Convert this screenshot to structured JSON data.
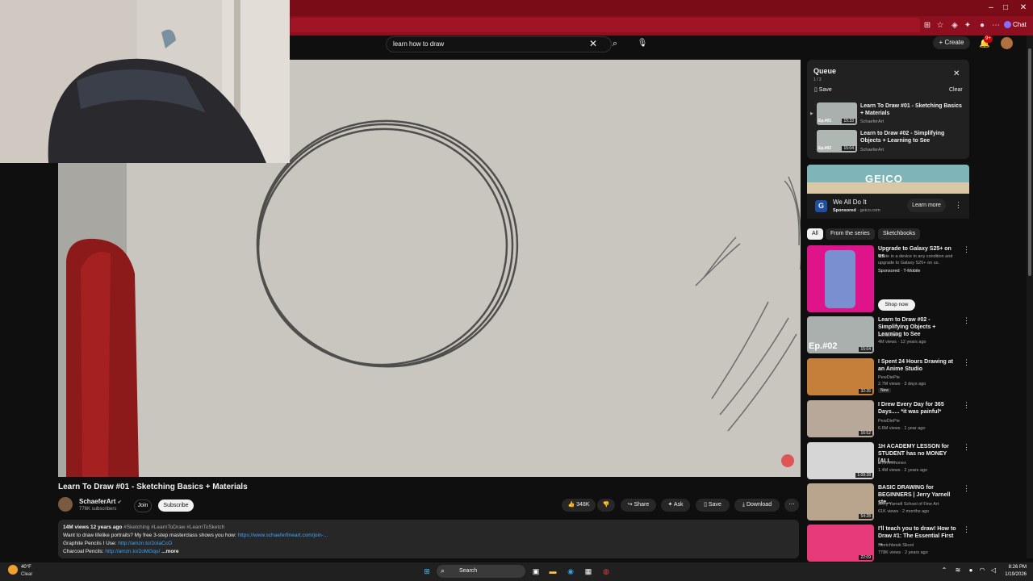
{
  "browser": {
    "window_buttons": {
      "minimize": "–",
      "maximize": "□",
      "close": "✕"
    },
    "chat_label": "Chat",
    "toolbar_icons": [
      "extension-icon",
      "star-icon",
      "shield-icon",
      "puzzle-icon",
      "split-icon",
      "profile-icon",
      "menu-icon"
    ]
  },
  "header": {
    "search_value": "learn how to draw",
    "create_label": "Create",
    "notifications_badge": "9+"
  },
  "video": {
    "title": "Learn To Draw #01 - Sketching Basics + Materials",
    "channel": "SchaeferArt",
    "subscribers": "776K subscribers",
    "join_label": "Join",
    "subscribe_label": "Subscribe",
    "likes": "348K",
    "share_label": "Share",
    "ask_label": "Ask",
    "save_label": "Save",
    "download_label": "Download",
    "description": {
      "meta": "14M views  12 years ago",
      "hashtags": "#Sketching #LearnToDraw #LearnToSketch",
      "line1_text": "Want to draw lifelike portraits? My free 3-step masterclass shows you how: ",
      "line1_link": "https://www.schaeferfineart.com/join-...",
      "line2_text": "Graphite Pencils I Use: ",
      "line2_link": "http://amzn.to/2oIaCcO",
      "line3_text": "Charcoal Pencils: ",
      "line3_link": "http://amzn.to/2oMGqu/",
      "more": " ...more"
    }
  },
  "queue": {
    "title": "Queue",
    "position": "1 / 2",
    "save_label": "Save",
    "clear_label": "Clear",
    "items": [
      {
        "title": "Learn To Draw #01 - Sketching Basics + Materials",
        "channel": "SchaeferArt",
        "duration": "15:33",
        "badge": "Ep.#01"
      },
      {
        "title": "Learn to Draw #02 - Simplifying Objects + Learning to See",
        "channel": "SchaeferArt",
        "duration": "15:04",
        "badge": "Ep.#02"
      }
    ]
  },
  "ad": {
    "brand": "GEICO",
    "tagline": "We All Do It",
    "sponsored": "Sponsored",
    "domain": "· geico.com",
    "learn_more": "Learn more"
  },
  "chips": [
    "All",
    "From the series",
    "Sketchbooks"
  ],
  "recommendations": [
    {
      "title": "Upgrade to Galaxy S25+ on us",
      "line2": "Trade in a device in any condition and upgrade to Galaxy S25+ on us.",
      "line3": "Sponsored · T-Mobile",
      "cta": "Shop now",
      "duration": ""
    },
    {
      "title": "Learn to Draw #02 - Simplifying Objects + Learning to See",
      "line2": "SchaeferArt",
      "line3": "4M views · 12 years ago",
      "duration": "15:04",
      "badge": "Ep.#02"
    },
    {
      "title": "I Spent 24 Hours Drawing at an Anime Studio",
      "line2": "PewDiePie",
      "line3": "2.7M views · 3 days ago",
      "tag": "New",
      "duration": "32:35"
    },
    {
      "title": "I Drew Every Day for 365 Days..... *it was painful*",
      "line2": "PewDiePie",
      "line3": "6.6M views · 1 year ago",
      "duration": "16:52"
    },
    {
      "title": "1H ACADEMY LESSON for STUDENT has no MONEY [ALL...",
      "line2": "Mmmmmonex",
      "line3": "1.4M views · 2 years ago",
      "duration": "1:09:28"
    },
    {
      "title": "BASIC DRAWING for BEGINNERS | Jerry Yarnell ste...",
      "line2": "Jerry Yarnell School of Fine Art",
      "line3": "61K views · 2 months ago",
      "duration": "54:28"
    },
    {
      "title": "I'll teach you to draw! How to Draw #1: The Essential First ...",
      "line2": "Sketchbook Skool",
      "line3": "778K views · 2 years ago",
      "duration": "22:09"
    }
  ],
  "taskbar": {
    "weather_temp": "40°F",
    "weather_cond": "Clear",
    "search_label": "Search",
    "time": "8:26 PM",
    "date": "1/19/2026"
  },
  "colors": {
    "accent_red": "#cc0000",
    "chrome_red": "#8e1020",
    "link_blue": "#3ea6ff"
  }
}
